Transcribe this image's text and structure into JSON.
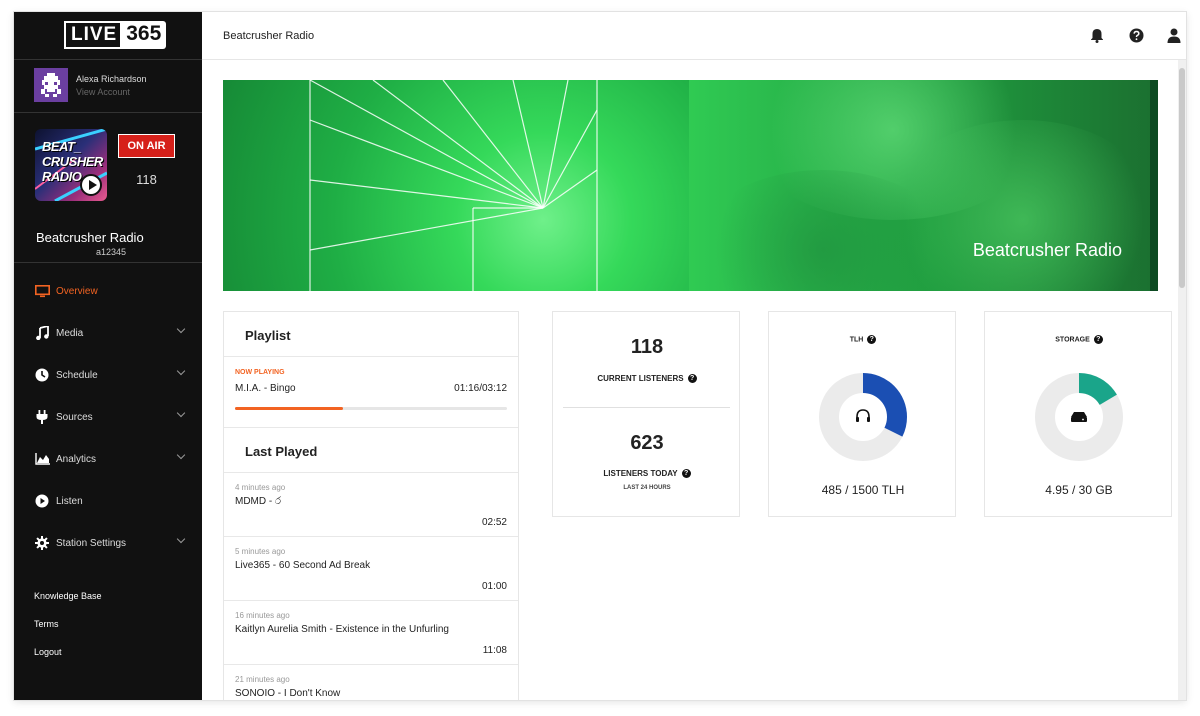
{
  "app": {
    "logo_left": "LIVE",
    "logo_right": "365"
  },
  "user": {
    "name": "Alexa Richardson",
    "view_account": "View Account"
  },
  "station": {
    "art_text": "BEAT\nCRUSHER\nRADIO",
    "on_air": "ON AIR",
    "listeners": "118",
    "name": "Beatcrusher Radio",
    "id": "a12345"
  },
  "nav": [
    {
      "label": "Overview",
      "icon": "monitor-icon",
      "active": true
    },
    {
      "label": "Media",
      "icon": "music-note-icon"
    },
    {
      "label": "Schedule",
      "icon": "clock-icon"
    },
    {
      "label": "Sources",
      "icon": "plug-icon"
    },
    {
      "label": "Analytics",
      "icon": "area-chart-icon"
    },
    {
      "label": "Listen",
      "icon": "play-circle-icon"
    },
    {
      "label": "Station Settings",
      "icon": "gear-icon"
    }
  ],
  "footer": {
    "knowledge_base": "Knowledge Base",
    "terms": "Terms",
    "logout": "Logout"
  },
  "topbar": {
    "title": "Beatcrusher Radio",
    "icons": [
      "bell-icon",
      "help-icon",
      "user-icon"
    ]
  },
  "banner": {
    "title": "Beatcrusher Radio"
  },
  "playlist": {
    "title": "Playlist",
    "now_playing_label": "NOW PLAYING",
    "now_track": "M.I.A. - Bingo",
    "now_time": "01:16/03:12",
    "progress": 0.396,
    "last_played_title": "Last Played",
    "items": [
      {
        "ago": "4 minutes ago",
        "track": "MDMD - ර",
        "duration": "02:52"
      },
      {
        "ago": "5 minutes ago",
        "track": "Live365 - 60 Second Ad Break",
        "duration": "01:00"
      },
      {
        "ago": "16 minutes ago",
        "track": "Kaitlyn Aurelia Smith - Existence in the Unfurling",
        "duration": "11:08"
      },
      {
        "ago": "21 minutes ago",
        "track": "SONOIO - I Don't Know",
        "duration": ""
      }
    ]
  },
  "listeners": {
    "current": "118",
    "current_label": "CURRENT LISTENERS",
    "today": "623",
    "today_label": "LISTENERS TODAY",
    "today_sub": "LAST 24 HOURS"
  },
  "tlh": {
    "label": "TLH",
    "value": "485 / 1500 TLH",
    "used": 485,
    "total": 1500,
    "color": "#1b4fb3",
    "icon": "headphones-icon"
  },
  "storage": {
    "label": "STORAGE",
    "value": "4.95 / 30 GB",
    "used": 4.95,
    "total": 30,
    "color": "#1aa58a",
    "icon": "hard-drive-icon"
  },
  "colors": {
    "accent": "#f26322",
    "on_air": "#d6201a",
    "sidebar": "#111111"
  }
}
